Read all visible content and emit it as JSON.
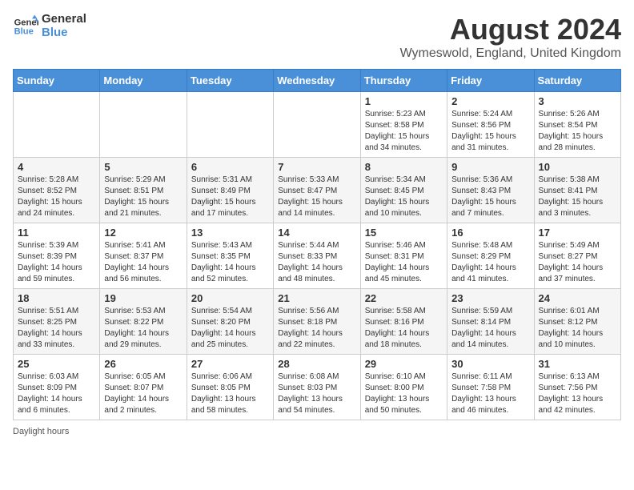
{
  "header": {
    "logo_line1": "General",
    "logo_line2": "Blue",
    "main_title": "August 2024",
    "subtitle": "Wymeswold, England, United Kingdom"
  },
  "days_of_week": [
    "Sunday",
    "Monday",
    "Tuesday",
    "Wednesday",
    "Thursday",
    "Friday",
    "Saturday"
  ],
  "weeks": [
    [
      {
        "day": "",
        "info": ""
      },
      {
        "day": "",
        "info": ""
      },
      {
        "day": "",
        "info": ""
      },
      {
        "day": "",
        "info": ""
      },
      {
        "day": "1",
        "info": "Sunrise: 5:23 AM\nSunset: 8:58 PM\nDaylight: 15 hours and 34 minutes."
      },
      {
        "day": "2",
        "info": "Sunrise: 5:24 AM\nSunset: 8:56 PM\nDaylight: 15 hours and 31 minutes."
      },
      {
        "day": "3",
        "info": "Sunrise: 5:26 AM\nSunset: 8:54 PM\nDaylight: 15 hours and 28 minutes."
      }
    ],
    [
      {
        "day": "4",
        "info": "Sunrise: 5:28 AM\nSunset: 8:52 PM\nDaylight: 15 hours and 24 minutes."
      },
      {
        "day": "5",
        "info": "Sunrise: 5:29 AM\nSunset: 8:51 PM\nDaylight: 15 hours and 21 minutes."
      },
      {
        "day": "6",
        "info": "Sunrise: 5:31 AM\nSunset: 8:49 PM\nDaylight: 15 hours and 17 minutes."
      },
      {
        "day": "7",
        "info": "Sunrise: 5:33 AM\nSunset: 8:47 PM\nDaylight: 15 hours and 14 minutes."
      },
      {
        "day": "8",
        "info": "Sunrise: 5:34 AM\nSunset: 8:45 PM\nDaylight: 15 hours and 10 minutes."
      },
      {
        "day": "9",
        "info": "Sunrise: 5:36 AM\nSunset: 8:43 PM\nDaylight: 15 hours and 7 minutes."
      },
      {
        "day": "10",
        "info": "Sunrise: 5:38 AM\nSunset: 8:41 PM\nDaylight: 15 hours and 3 minutes."
      }
    ],
    [
      {
        "day": "11",
        "info": "Sunrise: 5:39 AM\nSunset: 8:39 PM\nDaylight: 14 hours and 59 minutes."
      },
      {
        "day": "12",
        "info": "Sunrise: 5:41 AM\nSunset: 8:37 PM\nDaylight: 14 hours and 56 minutes."
      },
      {
        "day": "13",
        "info": "Sunrise: 5:43 AM\nSunset: 8:35 PM\nDaylight: 14 hours and 52 minutes."
      },
      {
        "day": "14",
        "info": "Sunrise: 5:44 AM\nSunset: 8:33 PM\nDaylight: 14 hours and 48 minutes."
      },
      {
        "day": "15",
        "info": "Sunrise: 5:46 AM\nSunset: 8:31 PM\nDaylight: 14 hours and 45 minutes."
      },
      {
        "day": "16",
        "info": "Sunrise: 5:48 AM\nSunset: 8:29 PM\nDaylight: 14 hours and 41 minutes."
      },
      {
        "day": "17",
        "info": "Sunrise: 5:49 AM\nSunset: 8:27 PM\nDaylight: 14 hours and 37 minutes."
      }
    ],
    [
      {
        "day": "18",
        "info": "Sunrise: 5:51 AM\nSunset: 8:25 PM\nDaylight: 14 hours and 33 minutes."
      },
      {
        "day": "19",
        "info": "Sunrise: 5:53 AM\nSunset: 8:22 PM\nDaylight: 14 hours and 29 minutes."
      },
      {
        "day": "20",
        "info": "Sunrise: 5:54 AM\nSunset: 8:20 PM\nDaylight: 14 hours and 25 minutes."
      },
      {
        "day": "21",
        "info": "Sunrise: 5:56 AM\nSunset: 8:18 PM\nDaylight: 14 hours and 22 minutes."
      },
      {
        "day": "22",
        "info": "Sunrise: 5:58 AM\nSunset: 8:16 PM\nDaylight: 14 hours and 18 minutes."
      },
      {
        "day": "23",
        "info": "Sunrise: 5:59 AM\nSunset: 8:14 PM\nDaylight: 14 hours and 14 minutes."
      },
      {
        "day": "24",
        "info": "Sunrise: 6:01 AM\nSunset: 8:12 PM\nDaylight: 14 hours and 10 minutes."
      }
    ],
    [
      {
        "day": "25",
        "info": "Sunrise: 6:03 AM\nSunset: 8:09 PM\nDaylight: 14 hours and 6 minutes."
      },
      {
        "day": "26",
        "info": "Sunrise: 6:05 AM\nSunset: 8:07 PM\nDaylight: 14 hours and 2 minutes."
      },
      {
        "day": "27",
        "info": "Sunrise: 6:06 AM\nSunset: 8:05 PM\nDaylight: 13 hours and 58 minutes."
      },
      {
        "day": "28",
        "info": "Sunrise: 6:08 AM\nSunset: 8:03 PM\nDaylight: 13 hours and 54 minutes."
      },
      {
        "day": "29",
        "info": "Sunrise: 6:10 AM\nSunset: 8:00 PM\nDaylight: 13 hours and 50 minutes."
      },
      {
        "day": "30",
        "info": "Sunrise: 6:11 AM\nSunset: 7:58 PM\nDaylight: 13 hours and 46 minutes."
      },
      {
        "day": "31",
        "info": "Sunrise: 6:13 AM\nSunset: 7:56 PM\nDaylight: 13 hours and 42 minutes."
      }
    ]
  ],
  "footer": "Daylight hours"
}
